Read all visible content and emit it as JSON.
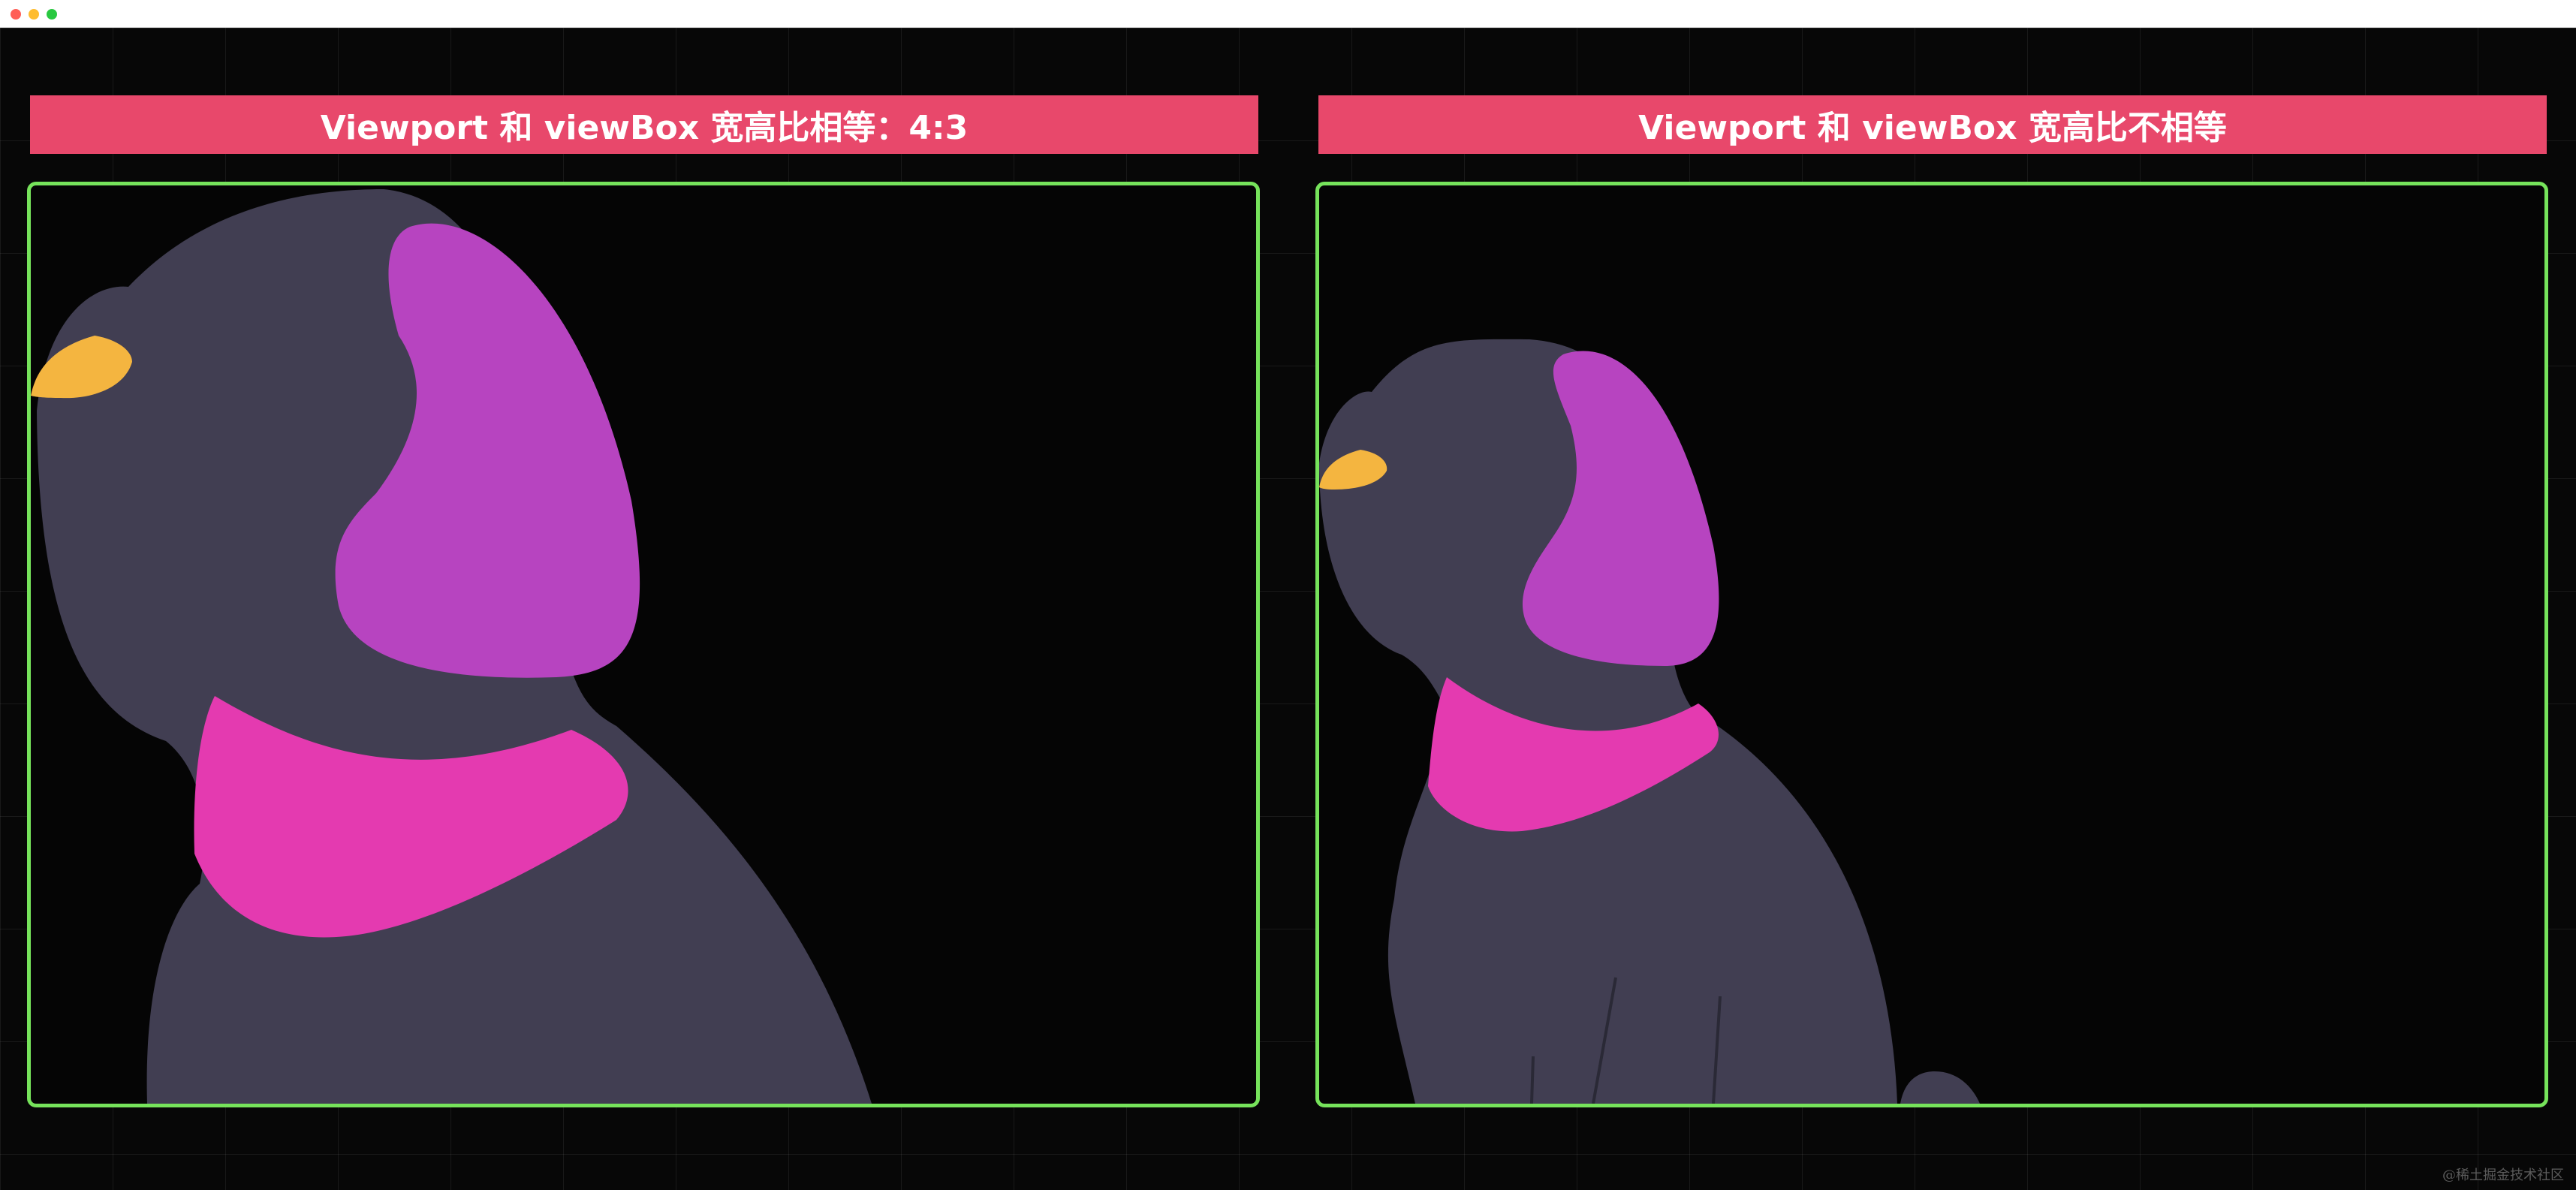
{
  "window": {
    "controls": [
      "close",
      "minimize",
      "maximize"
    ]
  },
  "panels": [
    {
      "title": "Viewport 和 viewBox 宽高比相等：4:3"
    },
    {
      "title": "Viewport 和 viewBox 宽高比不相等"
    }
  ],
  "watermark": "@稀土掘金技术社区",
  "colors": {
    "title_bar_bg": "#e8486b",
    "frame_border": "#76e35b",
    "dog_body": "#413e52",
    "dog_ear": "#b744c0",
    "dog_collar": "#e43ab0",
    "dog_nose": "#f4b540",
    "page_bg": "#070707"
  },
  "icons": {
    "dog_illustration": "dog-illustration"
  }
}
